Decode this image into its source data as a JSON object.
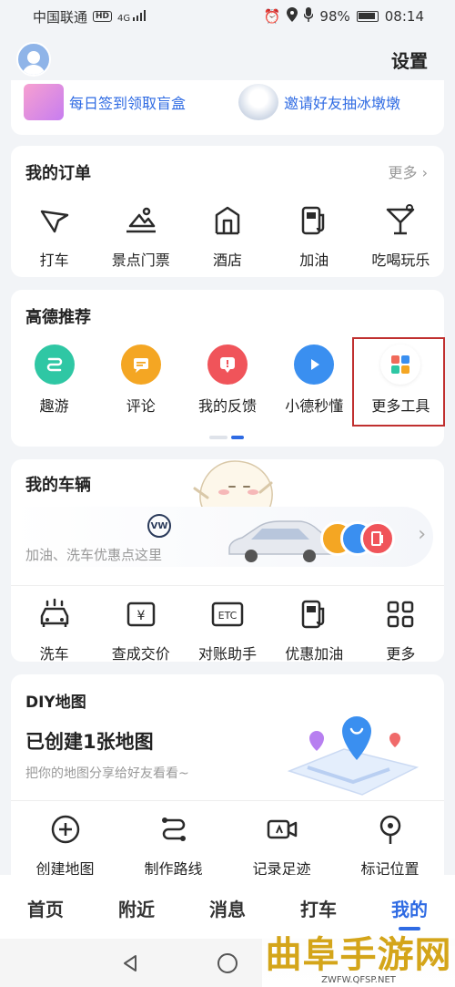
{
  "status": {
    "carrier": "中国联通",
    "hd": "HD",
    "signal": "4G",
    "battery": "98%",
    "time": "08:14"
  },
  "header": {
    "settings": "设置"
  },
  "banner": {
    "left_text": "每日签到领取盲盒",
    "right_text": "邀请好友抽冰墩墩"
  },
  "orders": {
    "title": "我的订单",
    "more": "更多",
    "items": [
      {
        "label": "打车",
        "icon": "taxi-icon"
      },
      {
        "label": "景点门票",
        "icon": "mountain-icon"
      },
      {
        "label": "酒店",
        "icon": "hotel-icon"
      },
      {
        "label": "加油",
        "icon": "fuel-icon"
      },
      {
        "label": "吃喝玩乐",
        "icon": "cocktail-icon"
      }
    ]
  },
  "recommend": {
    "title": "高德推荐",
    "items": [
      {
        "label": "趣游",
        "icon": "route-icon",
        "color": "#2fc7a4"
      },
      {
        "label": "评论",
        "icon": "comment-icon",
        "color": "#f4a623"
      },
      {
        "label": "我的反馈",
        "icon": "feedback-icon",
        "color": "#f0545a"
      },
      {
        "label": "小德秒懂",
        "icon": "play-icon",
        "color": "#3a8ff0"
      },
      {
        "label": "更多工具",
        "icon": "apps-icon",
        "color": "#ffffff"
      }
    ]
  },
  "vehicle": {
    "title": "我的车辆",
    "hint": "加油、洗车优惠点这里",
    "brand": "VW",
    "items": [
      {
        "label": "洗车",
        "icon": "car-wash-icon"
      },
      {
        "label": "查成交价",
        "icon": "price-tag-icon"
      },
      {
        "label": "对账助手",
        "icon": "etc-icon"
      },
      {
        "label": "优惠加油",
        "icon": "fuel-discount-icon"
      },
      {
        "label": "更多",
        "icon": "grid-icon"
      }
    ],
    "etc_text": "ETC",
    "yen": "¥"
  },
  "diy": {
    "title": "DIY地图",
    "headline": "已创建1张地图",
    "sub": "把你的地图分享给好友看看~",
    "items": [
      {
        "label": "创建地图",
        "icon": "add-circle-icon"
      },
      {
        "label": "制作路线",
        "icon": "route-line-icon"
      },
      {
        "label": "记录足迹",
        "icon": "video-icon"
      },
      {
        "label": "标记位置",
        "icon": "location-pin-icon"
      }
    ]
  },
  "tabs": [
    {
      "label": "首页"
    },
    {
      "label": "附近"
    },
    {
      "label": "消息"
    },
    {
      "label": "打车"
    },
    {
      "label": "我的"
    }
  ],
  "watermark": {
    "title": "曲阜手游网",
    "url": "ZWFW.QFSP.NET"
  },
  "colors": {
    "accent": "#2f6be3",
    "highlight": "#c0302f"
  }
}
